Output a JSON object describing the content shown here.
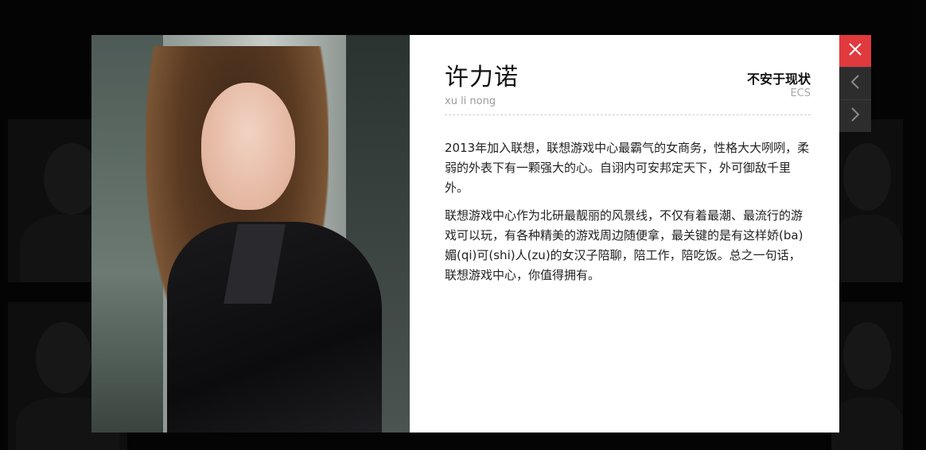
{
  "profile": {
    "name": "许力诺",
    "pinyin": "xu li nong",
    "motto": "不安于现状",
    "department": "ECS",
    "bio": [
      "2013年加入联想，联想游戏中心最霸气的女商务，性格大大咧咧，柔弱的外表下有一颗强大的心。自诩内可安邦定天下，外可御敌千里外。",
      "联想游戏中心作为北研最靓丽的风景线，不仅有着最潮、最流行的游戏可以玩，有各种精美的游戏周边随便拿，最关键的是有这样娇(ba)媚(qi)可(shi)人(zu)的女汉子陪聊，陪工作，陪吃饭。总之一句话，联想游戏中心，你值得拥有。"
    ]
  },
  "controls": {
    "close_icon": "close-icon",
    "prev_icon": "chevron-left-icon",
    "next_icon": "chevron-right-icon"
  },
  "colors": {
    "close_bg": "#e0393e",
    "nav_bg": "#2d2d2d",
    "backdrop": "#0b0b0b"
  }
}
